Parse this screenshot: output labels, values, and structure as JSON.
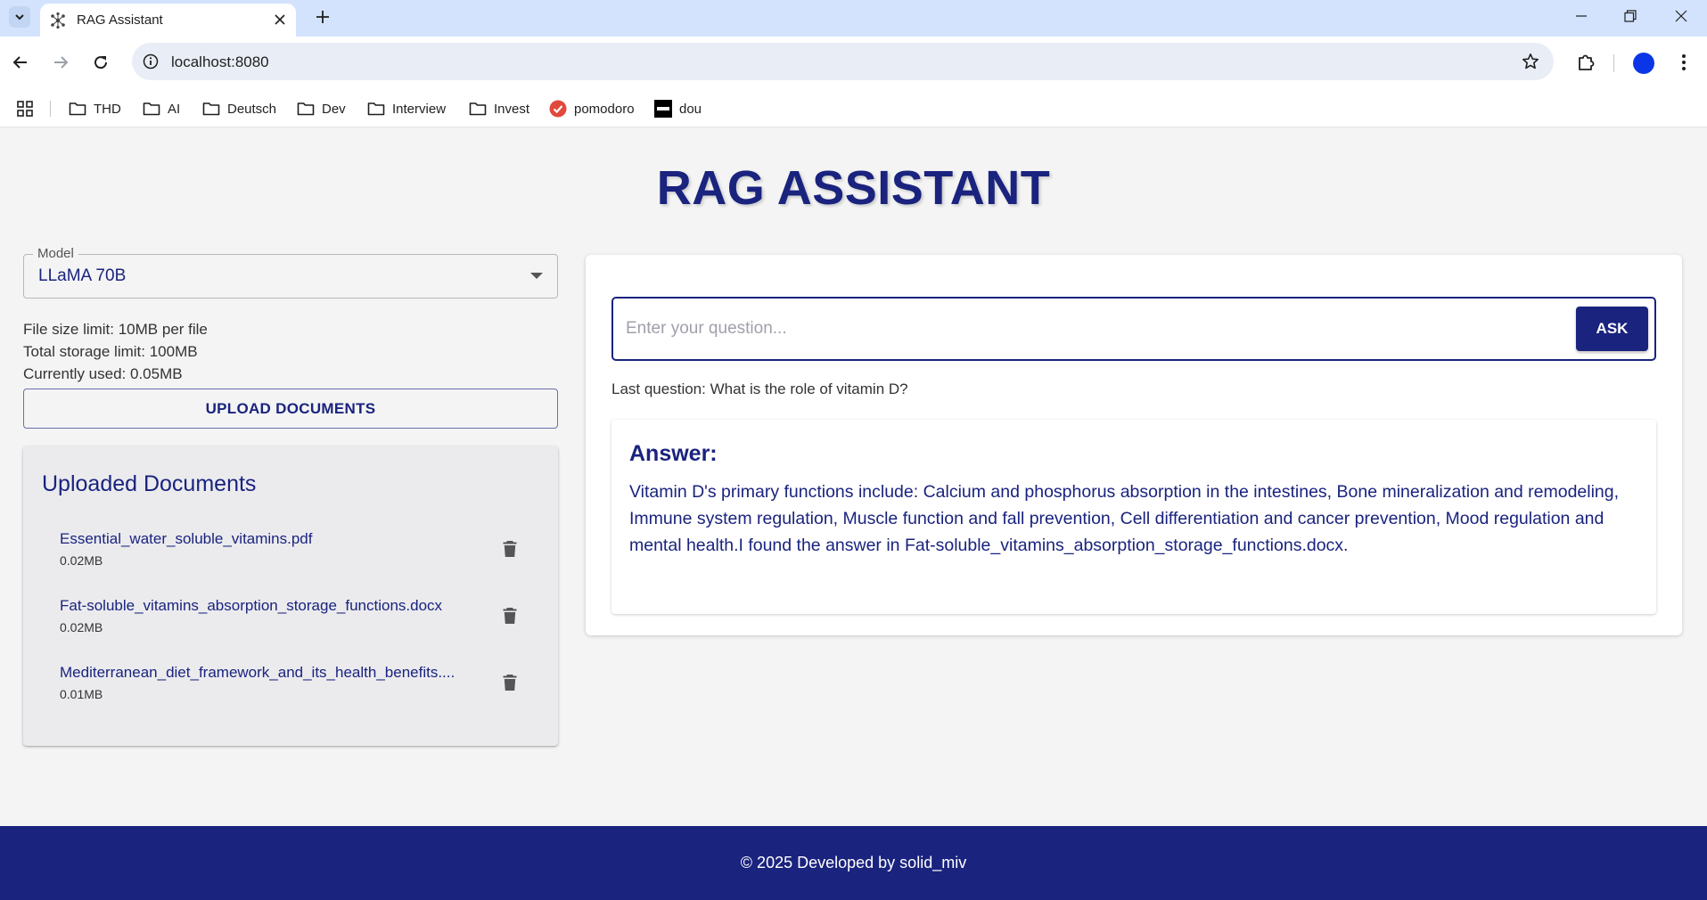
{
  "browser": {
    "tab_title": "RAG Assistant",
    "url": "localhost:8080",
    "bookmarks": [
      {
        "label": "THD",
        "icon": "folder-icon"
      },
      {
        "label": "AI",
        "icon": "folder-icon"
      },
      {
        "label": "Deutsch",
        "icon": "folder-icon"
      },
      {
        "label": "Dev",
        "icon": "folder-icon"
      },
      {
        "label": "Interview",
        "icon": "folder-icon"
      },
      {
        "label": "Invest",
        "icon": "folder-icon"
      },
      {
        "label": "pomodoro",
        "icon": "pomodoro-check-icon"
      },
      {
        "label": "dou",
        "icon": "dou-logo-icon"
      }
    ],
    "profile_color": "#0b36e8"
  },
  "app": {
    "title": "RAG ASSISTANT",
    "accent_color": "#1a237e"
  },
  "model": {
    "label": "Model",
    "selected": "LLaMA 70B"
  },
  "limits": {
    "file_size": "File size limit: 10MB per file",
    "total_storage": "Total storage limit: 100MB",
    "used": "Currently used: 0.05MB"
  },
  "upload": {
    "label": "UPLOAD DOCUMENTS"
  },
  "documents": {
    "title": "Uploaded Documents",
    "items": [
      {
        "name": "Essential_water_soluble_vitamins.pdf",
        "size": "0.02MB"
      },
      {
        "name": "Fat-soluble_vitamins_absorption_storage_functions.docx",
        "size": "0.02MB"
      },
      {
        "name": "Mediterranean_diet_framework_and_its_health_benefits....",
        "size": "0.01MB"
      }
    ]
  },
  "question": {
    "placeholder": "Enter your question...",
    "ask_label": "ASK",
    "last_question": "Last question: What is the role of vitamin D?"
  },
  "answer": {
    "title": "Answer:",
    "text": "Vitamin D's primary functions include: Calcium and phosphorus absorption in the intestines, Bone mineralization and remodeling, Immune system regulation, Muscle function and fall prevention, Cell differentiation and cancer prevention, Mood regulation and mental health.I found the answer in Fat-soluble_vitamins_absorption_storage_functions.docx."
  },
  "footer": {
    "text": "© 2025 Developed by solid_miv"
  }
}
